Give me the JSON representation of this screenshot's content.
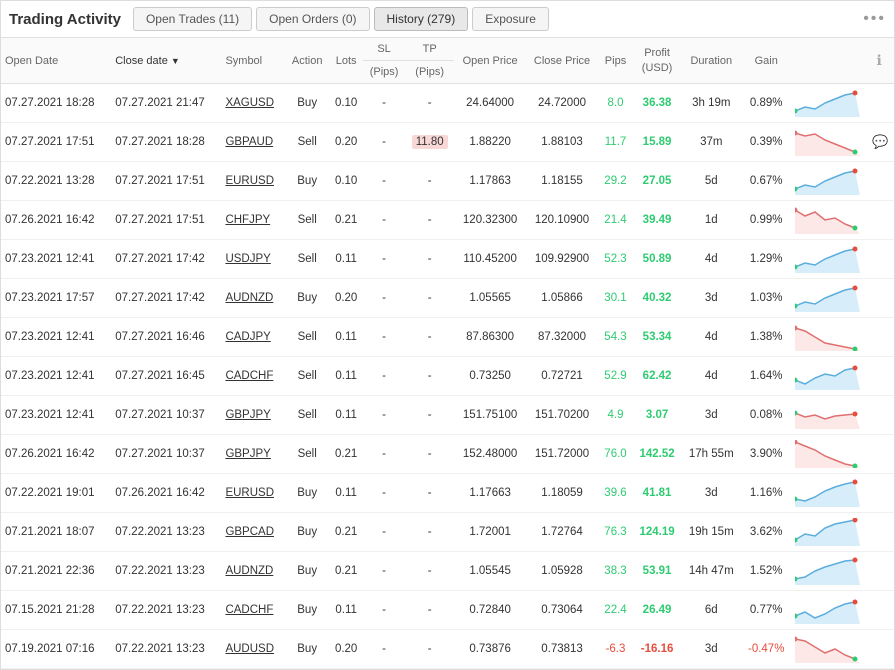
{
  "title": "Trading Activity",
  "tabs": [
    {
      "id": "open-trades",
      "label": "Open Trades (11)",
      "active": false
    },
    {
      "id": "open-orders",
      "label": "Open Orders (0)",
      "active": false
    },
    {
      "id": "history",
      "label": "History (279)",
      "active": true
    },
    {
      "id": "exposure",
      "label": "Exposure",
      "active": false
    }
  ],
  "more_label": "•••",
  "columns": [
    {
      "id": "open-date",
      "label": "Open Date",
      "align": "left"
    },
    {
      "id": "close-date",
      "label": "Close date▼",
      "align": "left",
      "sort": true
    },
    {
      "id": "symbol",
      "label": "Symbol",
      "align": "left"
    },
    {
      "id": "action",
      "label": "Action",
      "align": "center"
    },
    {
      "id": "lots",
      "label": "Lots",
      "align": "center"
    },
    {
      "id": "sl-pips",
      "label": "SL (Pips)",
      "align": "center"
    },
    {
      "id": "tp-pips",
      "label": "TP (Pips)",
      "align": "center"
    },
    {
      "id": "open-price",
      "label": "Open Price",
      "align": "center"
    },
    {
      "id": "close-price",
      "label": "Close Price",
      "align": "center"
    },
    {
      "id": "pips",
      "label": "Pips",
      "align": "center"
    },
    {
      "id": "profit",
      "label": "Profit (USD)",
      "align": "center"
    },
    {
      "id": "duration",
      "label": "Duration",
      "align": "center"
    },
    {
      "id": "gain",
      "label": "Gain",
      "align": "center"
    },
    {
      "id": "chart",
      "label": "",
      "align": "center"
    },
    {
      "id": "info",
      "label": "ℹ",
      "align": "center"
    }
  ],
  "rows": [
    {
      "open_date": "07.27.2021 18:28",
      "close_date": "07.27.2021 21:47",
      "symbol": "XAGUSD",
      "action": "Buy",
      "lots": "0.10",
      "sl": "-",
      "tp": "-",
      "open_price": "24.64000",
      "close_price": "24.72000",
      "pips": "8.0",
      "pips_positive": true,
      "profit": "36.38",
      "profit_positive": true,
      "duration": "3h 19m",
      "gain": "0.89%",
      "tp_highlight": false,
      "chart_type": "up"
    },
    {
      "open_date": "07.27.2021 17:51",
      "close_date": "07.27.2021 18:28",
      "symbol": "GBPAUD",
      "action": "Sell",
      "lots": "0.20",
      "sl": "-",
      "tp": "11.80",
      "open_price": "1.88220",
      "close_price": "1.88103",
      "pips": "11.7",
      "pips_positive": true,
      "profit": "15.89",
      "profit_positive": true,
      "duration": "37m",
      "gain": "0.39%",
      "tp_highlight": true,
      "chart_type": "down",
      "has_comment": true
    },
    {
      "open_date": "07.22.2021 13:28",
      "close_date": "07.27.2021 17:51",
      "symbol": "EURUSD",
      "action": "Buy",
      "lots": "0.10",
      "sl": "-",
      "tp": "-",
      "open_price": "1.17863",
      "close_price": "1.18155",
      "pips": "29.2",
      "pips_positive": true,
      "profit": "27.05",
      "profit_positive": true,
      "duration": "5d",
      "gain": "0.67%",
      "tp_highlight": false,
      "chart_type": "up"
    },
    {
      "open_date": "07.26.2021 16:42",
      "close_date": "07.27.2021 17:51",
      "symbol": "CHFJPY",
      "action": "Sell",
      "lots": "0.21",
      "sl": "-",
      "tp": "-",
      "open_price": "120.32300",
      "close_price": "120.10900",
      "pips": "21.4",
      "pips_positive": true,
      "profit": "39.49",
      "profit_positive": true,
      "duration": "1d",
      "gain": "0.99%",
      "tp_highlight": false,
      "chart_type": "mixed_down"
    },
    {
      "open_date": "07.23.2021 12:41",
      "close_date": "07.27.2021 17:42",
      "symbol": "USDJPY",
      "action": "Sell",
      "lots": "0.11",
      "sl": "-",
      "tp": "-",
      "open_price": "110.45200",
      "close_price": "109.92900",
      "pips": "52.3",
      "pips_positive": true,
      "profit": "50.89",
      "profit_positive": true,
      "duration": "4d",
      "gain": "1.29%",
      "tp_highlight": false,
      "chart_type": "up"
    },
    {
      "open_date": "07.23.2021 17:57",
      "close_date": "07.27.2021 17:42",
      "symbol": "AUDNZD",
      "action": "Buy",
      "lots": "0.20",
      "sl": "-",
      "tp": "-",
      "open_price": "1.05565",
      "close_price": "1.05866",
      "pips": "30.1",
      "pips_positive": true,
      "profit": "40.32",
      "profit_positive": true,
      "duration": "3d",
      "gain": "1.03%",
      "tp_highlight": false,
      "chart_type": "up"
    },
    {
      "open_date": "07.23.2021 12:41",
      "close_date": "07.27.2021 16:46",
      "symbol": "CADJPY",
      "action": "Sell",
      "lots": "0.11",
      "sl": "-",
      "tp": "-",
      "open_price": "87.86300",
      "close_price": "87.32000",
      "pips": "54.3",
      "pips_positive": true,
      "profit": "53.34",
      "profit_positive": true,
      "duration": "4d",
      "gain": "1.38%",
      "tp_highlight": false,
      "chart_type": "down_good"
    },
    {
      "open_date": "07.23.2021 12:41",
      "close_date": "07.27.2021 16:45",
      "symbol": "CADCHF",
      "action": "Sell",
      "lots": "0.11",
      "sl": "-",
      "tp": "-",
      "open_price": "0.73250",
      "close_price": "0.72721",
      "pips": "52.9",
      "pips_positive": true,
      "profit": "62.42",
      "profit_positive": true,
      "duration": "4d",
      "gain": "1.64%",
      "tp_highlight": false,
      "chart_type": "mixed_up"
    },
    {
      "open_date": "07.23.2021 12:41",
      "close_date": "07.27.2021 10:37",
      "symbol": "GBPJPY",
      "action": "Sell",
      "lots": "0.11",
      "sl": "-",
      "tp": "-",
      "open_price": "151.75100",
      "close_price": "151.70200",
      "pips": "4.9",
      "pips_positive": true,
      "profit": "3.07",
      "profit_positive": true,
      "duration": "3d",
      "gain": "0.08%",
      "tp_highlight": false,
      "chart_type": "mixed_flat"
    },
    {
      "open_date": "07.26.2021 16:42",
      "close_date": "07.27.2021 10:37",
      "symbol": "GBPJPY",
      "action": "Sell",
      "lots": "0.21",
      "sl": "-",
      "tp": "-",
      "open_price": "152.48000",
      "close_price": "151.72000",
      "pips": "76.0",
      "pips_positive": true,
      "profit": "142.52",
      "profit_positive": true,
      "duration": "17h 55m",
      "gain": "3.90%",
      "tp_highlight": false,
      "chart_type": "down_good2"
    },
    {
      "open_date": "07.22.2021 19:01",
      "close_date": "07.26.2021 16:42",
      "symbol": "EURUSD",
      "action": "Buy",
      "lots": "0.11",
      "sl": "-",
      "tp": "-",
      "open_price": "1.17663",
      "close_price": "1.18059",
      "pips": "39.6",
      "pips_positive": true,
      "profit": "41.81",
      "profit_positive": true,
      "duration": "3d",
      "gain": "1.16%",
      "tp_highlight": false,
      "chart_type": "up2"
    },
    {
      "open_date": "07.21.2021 18:07",
      "close_date": "07.22.2021 13:23",
      "symbol": "GBPCAD",
      "action": "Buy",
      "lots": "0.21",
      "sl": "-",
      "tp": "-",
      "open_price": "1.72001",
      "close_price": "1.72764",
      "pips": "76.3",
      "pips_positive": true,
      "profit": "124.19",
      "profit_positive": true,
      "duration": "19h 15m",
      "gain": "3.62%",
      "tp_highlight": false,
      "chart_type": "up3"
    },
    {
      "open_date": "07.21.2021 22:36",
      "close_date": "07.22.2021 13:23",
      "symbol": "AUDNZD",
      "action": "Buy",
      "lots": "0.21",
      "sl": "-",
      "tp": "-",
      "open_price": "1.05545",
      "close_price": "1.05928",
      "pips": "38.3",
      "pips_positive": true,
      "profit": "53.91",
      "profit_positive": true,
      "duration": "14h 47m",
      "gain": "1.52%",
      "tp_highlight": false,
      "chart_type": "up4"
    },
    {
      "open_date": "07.15.2021 21:28",
      "close_date": "07.22.2021 13:23",
      "symbol": "CADCHF",
      "action": "Buy",
      "lots": "0.11",
      "sl": "-",
      "tp": "-",
      "open_price": "0.72840",
      "close_price": "0.73064",
      "pips": "22.4",
      "pips_positive": true,
      "profit": "26.49",
      "profit_positive": true,
      "duration": "6d",
      "gain": "0.77%",
      "tp_highlight": false,
      "chart_type": "mixed_up2"
    },
    {
      "open_date": "07.19.2021 07:16",
      "close_date": "07.22.2021 13:23",
      "symbol": "AUDUSD",
      "action": "Buy",
      "lots": "0.20",
      "sl": "-",
      "tp": "-",
      "open_price": "0.73876",
      "close_price": "0.73813",
      "pips": "-6.3",
      "pips_positive": false,
      "profit": "-16.16",
      "profit_positive": false,
      "duration": "3d",
      "gain": "-0.47%",
      "tp_highlight": false,
      "chart_type": "down_bad"
    }
  ]
}
